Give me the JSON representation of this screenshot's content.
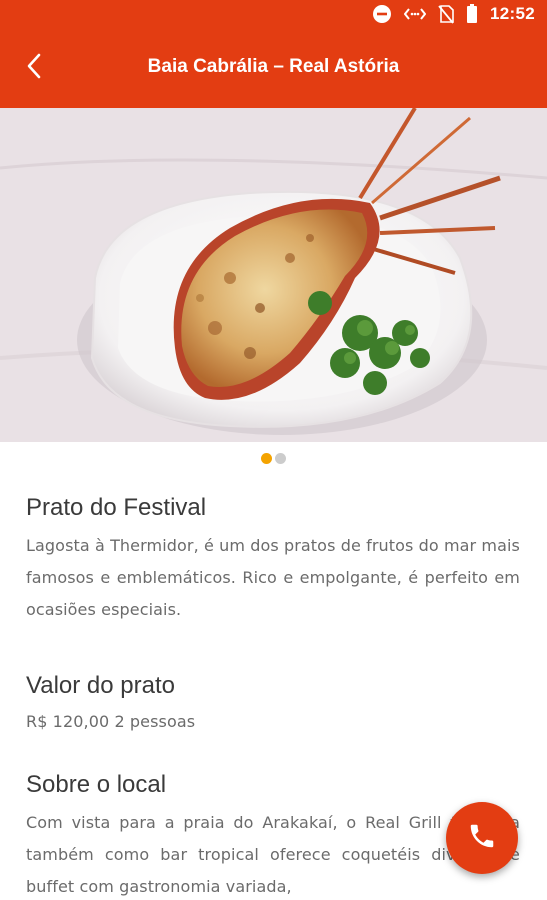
{
  "status_bar": {
    "time": "12:52",
    "icons": [
      "do-not-disturb-icon",
      "data-saver-icon",
      "no-sim-icon",
      "battery-icon"
    ]
  },
  "toolbar": {
    "title": "Baia Cabrália – Real Astória",
    "back_icon": "back-arrow-icon"
  },
  "gallery": {
    "image": "lobster-thermidor-photo",
    "page_count": 2,
    "current_page": 1
  },
  "sections": {
    "dish": {
      "heading": "Prato do Festival",
      "text": "Lagosta à Thermidor, é um dos pratos de frutos do mar mais famosos e emblemáticos. Rico e empolgante, é perfeito em ocasiões especiais."
    },
    "price": {
      "heading": "Valor do prato",
      "text": "R$ 120,00 2 pessoas"
    },
    "about": {
      "heading": "Sobre o local",
      "text": "Com vista para a praia do Arakakaí, o Real Grill funciona também como bar tropical oferece coquetéis diversos e buffet com gastronomia variada,"
    }
  },
  "fab": {
    "icon": "phone-icon"
  },
  "colors": {
    "primary": "#e33d12",
    "dot_active": "#f4a300",
    "dot_inactive": "#cccccc"
  }
}
